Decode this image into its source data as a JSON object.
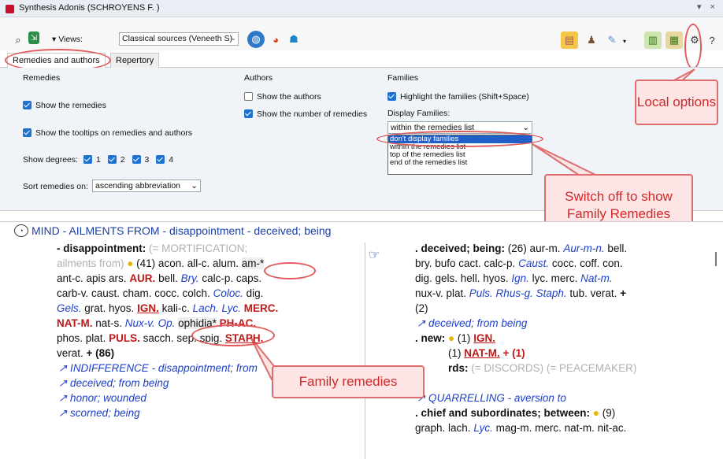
{
  "window": {
    "title": "Synthesis Adonis (SCHROYENS F. )",
    "controls": "▾ ×"
  },
  "toolbar": {
    "views_label": "▾ Views:",
    "views_value": "Classical sources (Veneeth S)"
  },
  "tabs": [
    "Remedies and authors",
    "Repertory"
  ],
  "remedies": {
    "title": "Remedies",
    "show_remedies": "Show the remedies",
    "show_tooltips": "Show the tooltips on remedies and authors",
    "degrees_label": "Show degrees:",
    "degrees": [
      "1",
      "2",
      "3",
      "4"
    ],
    "sort_label": "Sort remedies on:",
    "sort_value": "ascending abbreviation"
  },
  "authors": {
    "title": "Authors",
    "show_authors": "Show the authors",
    "show_number": "Show the number of remedies"
  },
  "families": {
    "title": "Families",
    "highlight": "Highlight the families (Shift+Space)",
    "display_label": "Display Families:",
    "display_value": "within the remedies list",
    "options": [
      "don't display families",
      "within the remedies list",
      "top of the remedies list",
      "end of the remedies list"
    ]
  },
  "callouts": {
    "local": "Local options",
    "switch": "Switch off to show Family Remedies",
    "family": "Family remedies"
  },
  "rubric": "MIND - AILMENTS FROM - disappointment - deceived; being",
  "left": {
    "l1a": "- disappointment:",
    "l1b": "(= MORTIFICATION;",
    "l2a": "ailments from)",
    "l2b": "(41) acon. all-c. alum.",
    "l2c": "am-*",
    "l3a": "ant-c. apis ars.",
    "l3b": "AUR.",
    "l3c": "bell.",
    "l3d": "Bry.",
    "l3e": "calc-p. caps.",
    "l4a": "carb-v. caust. cham. cocc. colch.",
    "l4b": "Coloc.",
    "l4c": "dig.",
    "l5a": "Gels.",
    "l5b": "grat. hyos.",
    "l5c": "IGN.",
    "l5d": "kali-c.",
    "l5e": "Lach.",
    "l5f": "Lyc.",
    "l5g": "MERC.",
    "l6a": "NAT-M.",
    "l6b": "nat-s.",
    "l6c": "Nux-v.",
    "l6d": "Op.",
    "l6e": "ophidia*",
    "l6f": "PH-AC.",
    "l7a": "phos. plat.",
    "l7b": "PULS.",
    "l7c": "sacch. sep. spig.",
    "l7d": "STAPH.",
    "l8a": "verat.",
    "l8b": "+ (86)",
    "x1": "↗ INDIFFERENCE - disappointment; from",
    "x2": "↗ deceived; from being",
    "x3": "↗ honor; wounded",
    "x4": "↗ scorned; being"
  },
  "right": {
    "r1a": ". deceived; being:",
    "r1b": "(26) aur-m.",
    "r1c": "Aur-m-n.",
    "r1d": "bell.",
    "r2a": "bry. bufo cact. calc-p.",
    "r2b": "Caust.",
    "r2c": "cocc. coff. con.",
    "r3a": "dig. gels. hell. hyos.",
    "r3b": "Ign.",
    "r3c": "lyc. merc.",
    "r3d": "Nat-m.",
    "r4a": "nux-v. plat.",
    "r4b": "Puls. Rhus-g. Staph.",
    "r4c": "tub. verat.",
    "r4d": "+",
    "r5": "(2)",
    "x1": "↗ deceived; from being",
    "r6a": ". new:",
    "r6b": "(1)",
    "r6c": "IGN.",
    "r7a": "(1)",
    "r7b": "NAT-M.",
    "r7c": "+ (1)",
    "r8a": "rds:",
    "r8b": "(= DISCORDS) (= PEACEMAKER)",
    "x2": "↗ QUARRELLING - aversion to",
    "r9a": ". chief and subordinates; between:",
    "r9b": "(9)",
    "r10": "graph. lach.",
    "r10b": "Lyc.",
    "r10c": "mag-m. merc. nat-m. nit-ac."
  }
}
